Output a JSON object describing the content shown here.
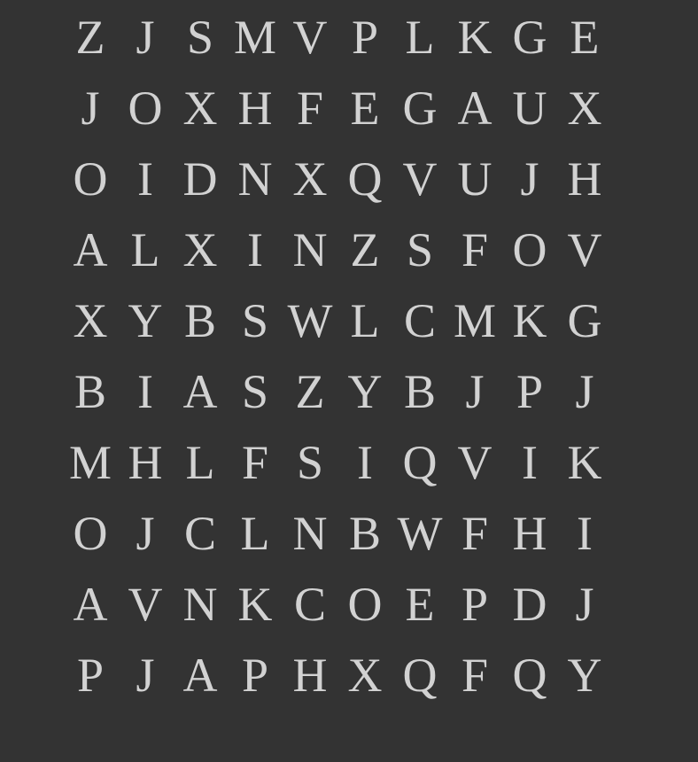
{
  "grid": {
    "rows": [
      [
        "Z",
        "J",
        "S",
        "M",
        "V",
        "P",
        "L",
        "K",
        "G",
        "E"
      ],
      [
        "J",
        "O",
        "X",
        "H",
        "F",
        "E",
        "G",
        "A",
        "U",
        "X"
      ],
      [
        "O",
        "I",
        "D",
        "N",
        "X",
        "Q",
        "V",
        "U",
        "J",
        "H"
      ],
      [
        "A",
        "L",
        "X",
        "I",
        "N",
        "Z",
        "S",
        "F",
        "O",
        "V"
      ],
      [
        "X",
        "Y",
        "B",
        "S",
        "W",
        "L",
        "C",
        "M",
        "K",
        "G"
      ],
      [
        "B",
        "I",
        "A",
        "S",
        "Z",
        "Y",
        "B",
        "J",
        "P",
        "J"
      ],
      [
        "M",
        "H",
        "L",
        "F",
        "S",
        "I",
        "Q",
        "V",
        "I",
        "K"
      ],
      [
        "O",
        "J",
        "C",
        "L",
        "N",
        "B",
        "W",
        "F",
        "H",
        "I"
      ],
      [
        "A",
        "V",
        "N",
        "K",
        "C",
        "O",
        "E",
        "P",
        "D",
        "J"
      ],
      [
        "P",
        "J",
        "A",
        "P",
        "H",
        "X",
        "Q",
        "F",
        "Q",
        "Y"
      ]
    ]
  },
  "colors": {
    "background": "#333333",
    "letter": "#d2d2d2"
  }
}
